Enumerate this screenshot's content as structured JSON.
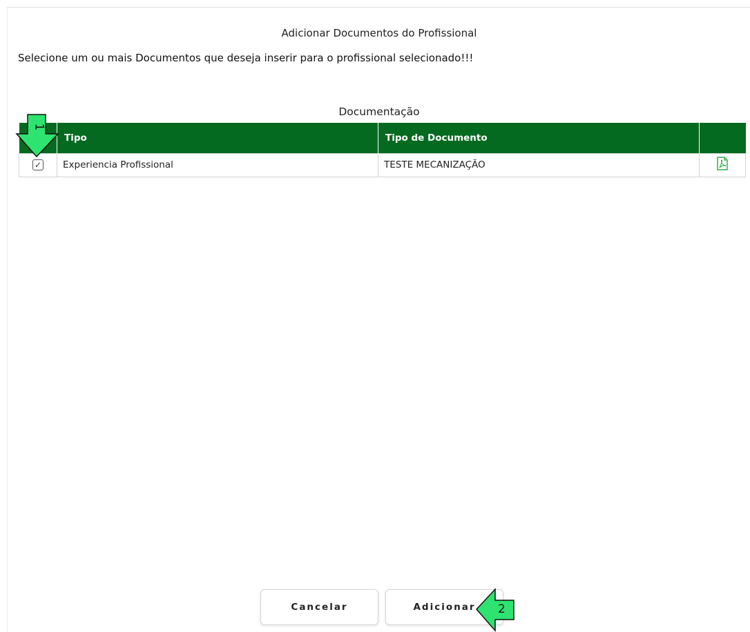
{
  "dialog": {
    "title": "Adicionar Documentos do Profissional",
    "instruction": "Selecione um ou mais Documentos que deseja inserir para o profissional selecionado!!!"
  },
  "section": {
    "title": "Documentação"
  },
  "table": {
    "headers": [
      "",
      "Tipo",
      "Tipo de Documento",
      ""
    ],
    "rows": [
      {
        "checked": true,
        "tipo": "Experiencia Profissional",
        "tipo_documento": "TESTE MECANIZAÇÃO",
        "action_icon": "pdf-icon"
      }
    ]
  },
  "buttons": {
    "cancel": "Cancelar",
    "add": "Adicionar"
  },
  "annotations": {
    "step1": "1",
    "step2": "2"
  },
  "colors": {
    "header_green": "#046a1f",
    "pdf_icon": "#2fae4c",
    "callout_green": "#2ee36f"
  }
}
